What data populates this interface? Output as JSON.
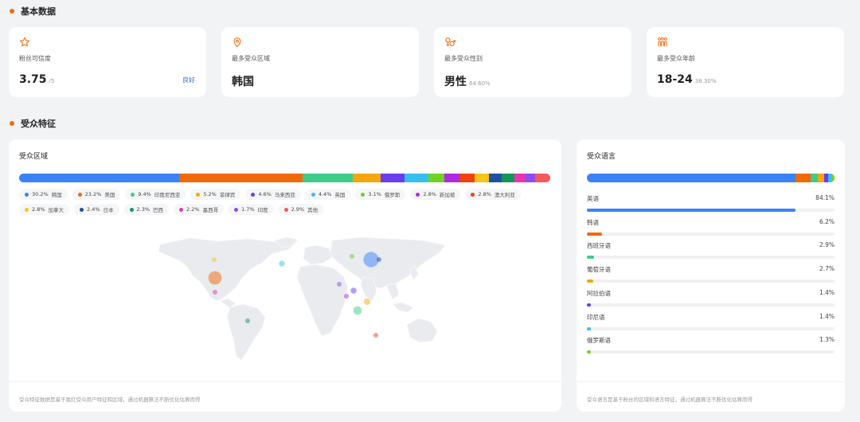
{
  "basic": {
    "title": "基本数据",
    "cards": [
      {
        "label": "粉丝可信度",
        "value": "3.75",
        "sub": "/5",
        "tag": "良好",
        "icon": "star-icon"
      },
      {
        "label": "最多受众区域",
        "value": "韩国",
        "sub": "",
        "icon": "location-pin-icon"
      },
      {
        "label": "最多受众性别",
        "value": "男性",
        "sub": "64.60%",
        "icon": "gender-icon"
      },
      {
        "label": "最多受众年龄",
        "value": "18-24",
        "sub": "38.30%",
        "icon": "people-icon"
      }
    ]
  },
  "audience": {
    "title": "受众特征",
    "region": {
      "title": "受众区域",
      "items": [
        {
          "name": "韩国",
          "pct": "30.2%",
          "value": 30.2,
          "color": "#3b82f6"
        },
        {
          "name": "美国",
          "pct": "23.2%",
          "value": 23.2,
          "color": "#f06a0a"
        },
        {
          "name": "印度尼西亚",
          "pct": "9.4%",
          "value": 9.4,
          "color": "#3ecb8a"
        },
        {
          "name": "菲律宾",
          "pct": "5.2%",
          "value": 5.2,
          "color": "#f5a60a"
        },
        {
          "name": "马来西亚",
          "pct": "4.6%",
          "value": 4.6,
          "color": "#6a3cf0"
        },
        {
          "name": "英国",
          "pct": "4.4%",
          "value": 4.4,
          "color": "#36c0f0"
        },
        {
          "name": "俄罗斯",
          "pct": "3.1%",
          "value": 3.1,
          "color": "#6ed321"
        },
        {
          "name": "新加坡",
          "pct": "2.8%",
          "value": 2.8,
          "color": "#b02ae0"
        },
        {
          "name": "澳大利亚",
          "pct": "2.8%",
          "value": 2.8,
          "color": "#f0420a"
        },
        {
          "name": "加拿大",
          "pct": "2.8%",
          "value": 2.8,
          "color": "#f5c518"
        },
        {
          "name": "日本",
          "pct": "2.4%",
          "value": 2.4,
          "color": "#1f4fa8"
        },
        {
          "name": "巴西",
          "pct": "2.3%",
          "value": 2.3,
          "color": "#12965a"
        },
        {
          "name": "墨西哥",
          "pct": "2.2%",
          "value": 2.2,
          "color": "#e834b0"
        },
        {
          "name": "印度",
          "pct": "1.7%",
          "value": 1.7,
          "color": "#8b4cf0"
        },
        {
          "name": "其他",
          "pct": "2.9%",
          "value": 2.9,
          "color": "#f45a5a"
        }
      ],
      "footnote": "受众特征数据是基于我红受众用户特征和区域，通过机器算法不断优化估算而得"
    },
    "language": {
      "title": "受众语言",
      "items": [
        {
          "name": "英语",
          "pct": "84.1%",
          "value": 84.1,
          "color": "#3b82f6"
        },
        {
          "name": "韩语",
          "pct": "6.2%",
          "value": 6.2,
          "color": "#f06a0a"
        },
        {
          "name": "西班牙语",
          "pct": "2.9%",
          "value": 2.9,
          "color": "#3ecb8a"
        },
        {
          "name": "葡萄牙语",
          "pct": "2.7%",
          "value": 2.7,
          "color": "#f5a60a"
        },
        {
          "name": "阿拉伯语",
          "pct": "1.4%",
          "value": 1.4,
          "color": "#6a3cf0"
        },
        {
          "name": "印尼语",
          "pct": "1.4%",
          "value": 1.4,
          "color": "#36c0f0"
        },
        {
          "name": "俄罗斯语",
          "pct": "1.3%",
          "value": 1.3,
          "color": "#6ed321"
        }
      ],
      "footnote": "受众语言是基于粉丝的区域和语言特征，通过机器算法不断优化估算而得"
    }
  }
}
